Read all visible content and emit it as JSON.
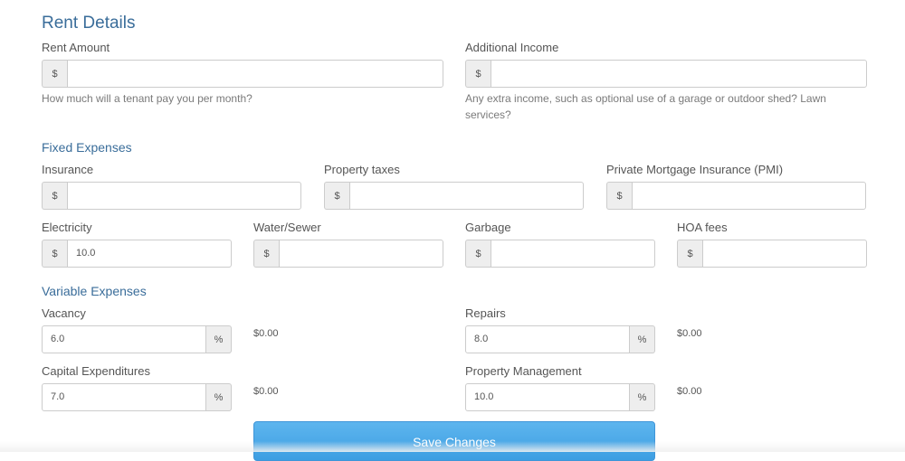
{
  "rent": {
    "title": "Rent Details",
    "rent_amount": {
      "label": "Rent Amount",
      "prefix": "$",
      "value": "",
      "help": "How much will a tenant pay you per month?"
    },
    "additional_income": {
      "label": "Additional Income",
      "prefix": "$",
      "value": "",
      "help_line1": "Any extra income, such as optional use of a garage or outdoor shed? Lawn",
      "help_line2": "services?"
    }
  },
  "fixed": {
    "title": "Fixed Expenses",
    "insurance": {
      "label": "Insurance",
      "prefix": "$",
      "value": ""
    },
    "property_taxes": {
      "label": "Property taxes",
      "prefix": "$",
      "value": ""
    },
    "pmi": {
      "label": "Private Mortgage Insurance (PMI)",
      "prefix": "$",
      "value": ""
    },
    "electricity": {
      "label": "Electricity",
      "prefix": "$",
      "value": "10.0"
    },
    "water_sewer": {
      "label": "Water/Sewer",
      "prefix": "$",
      "value": ""
    },
    "garbage": {
      "label": "Garbage",
      "prefix": "$",
      "value": ""
    },
    "hoa": {
      "label": "HOA fees",
      "prefix": "$",
      "value": ""
    }
  },
  "variable": {
    "title": "Variable Expenses",
    "vacancy": {
      "label": "Vacancy",
      "value": "6.0",
      "suffix": "%",
      "computed": "$0.00"
    },
    "repairs": {
      "label": "Repairs",
      "value": "8.0",
      "suffix": "%",
      "computed": "$0.00"
    },
    "capex": {
      "label": "Capital Expenditures",
      "value": "7.0",
      "suffix": "%",
      "computed": "$0.00"
    },
    "management": {
      "label": "Property Management",
      "value": "10.0",
      "suffix": "%",
      "computed": "$0.00"
    }
  },
  "actions": {
    "save_label": "Save Changes"
  },
  "colors": {
    "heading": "#3a6d9a",
    "button": "#4aa8e8"
  }
}
